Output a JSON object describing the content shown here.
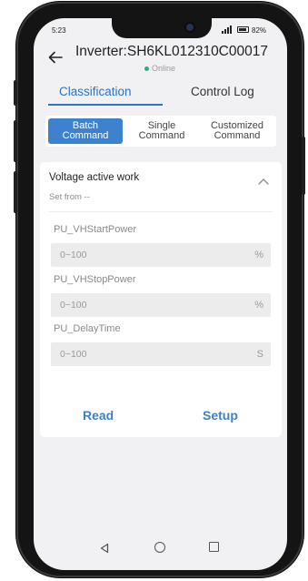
{
  "status_bar": {
    "time": "5:23",
    "battery_percent": "82%",
    "battery_level": 0.82
  },
  "header": {
    "title": "Inverter:SH6KL012310C00017",
    "status": "Online",
    "status_color": "#2ab27b"
  },
  "tabs": [
    {
      "label": "Classification",
      "active": true
    },
    {
      "label": "Control Log",
      "active": false
    }
  ],
  "segment": [
    {
      "label": "Batch\nCommand",
      "active": true
    },
    {
      "label": "Single\nCommand",
      "active": false
    },
    {
      "label": "Customized\nCommand",
      "active": false
    }
  ],
  "card": {
    "title": "Voltage active work",
    "set_from": "Set from --",
    "fields": [
      {
        "label": "PU_VHStartPower",
        "placeholder": "0~100",
        "unit": "%"
      },
      {
        "label": "PU_VHStopPower",
        "placeholder": "0~100",
        "unit": "%"
      },
      {
        "label": "PU_DelayTime",
        "placeholder": "0~100",
        "unit": "S"
      }
    ],
    "read_label": "Read",
    "setup_label": "Setup"
  },
  "colors": {
    "accent": "#2a74c3",
    "segment_active": "#3d82cc",
    "action_text": "#3f7fc2"
  },
  "icons": {
    "back": "arrow-left-icon",
    "collapse": "chevron-up-icon",
    "nav_back": "triangle-back-icon",
    "nav_home": "circle-home-icon",
    "nav_recent": "square-recent-icon"
  }
}
